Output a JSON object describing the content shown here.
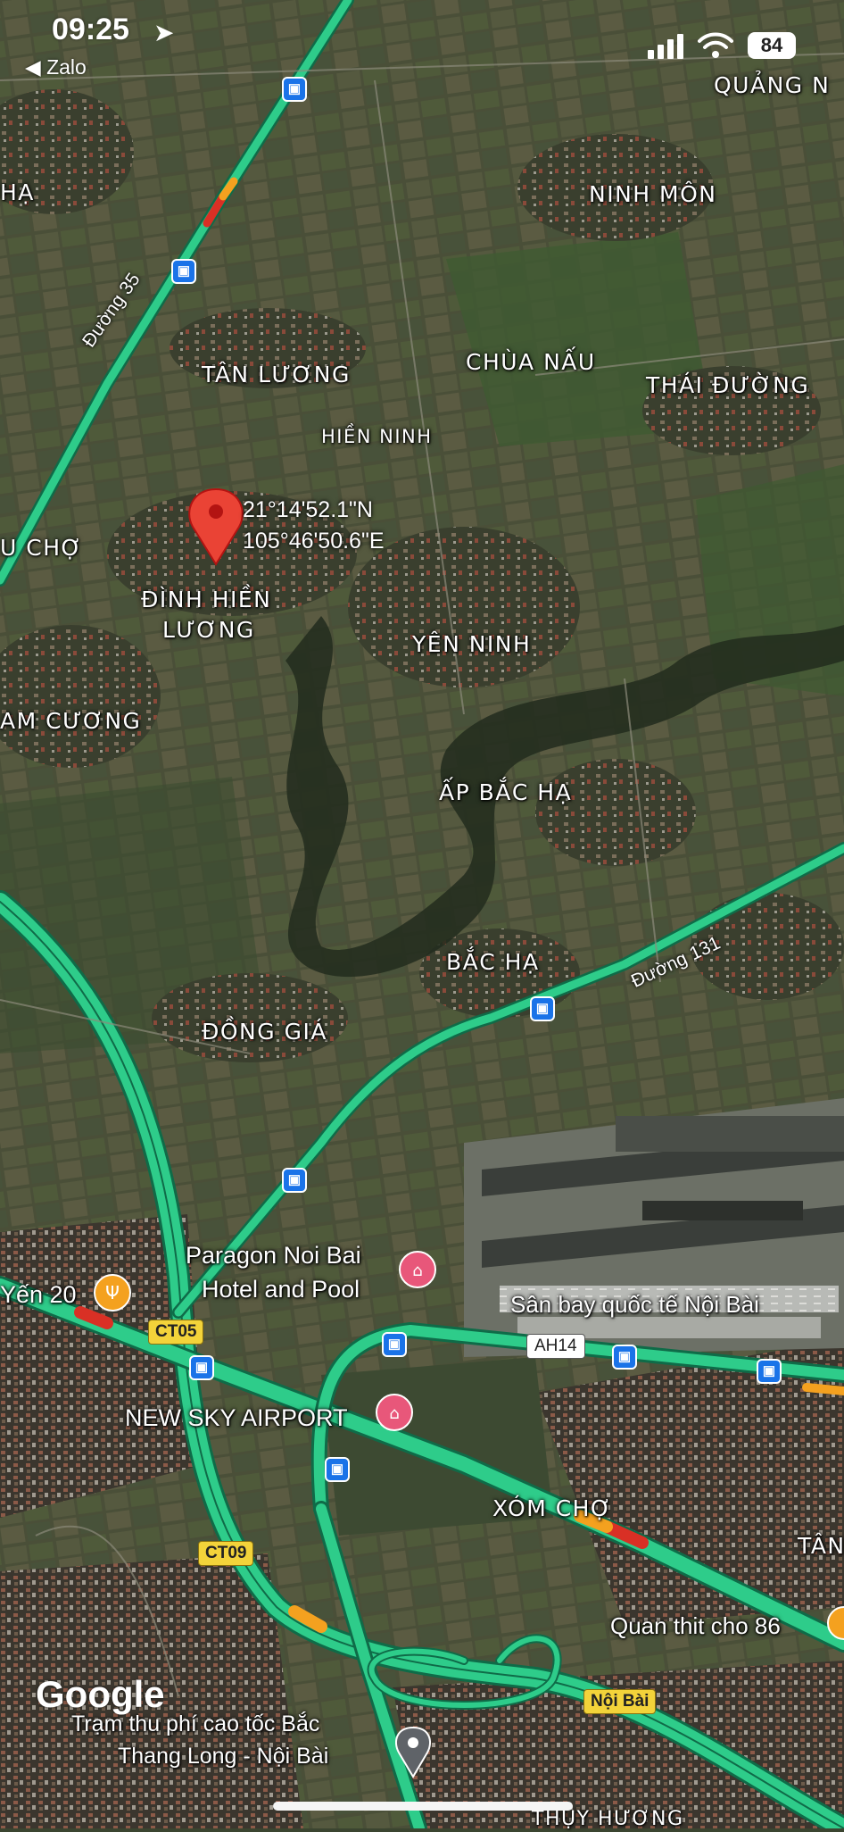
{
  "status_bar": {
    "time": "09:25",
    "back_app": "◀ Zalo",
    "battery": "84"
  },
  "pin": {
    "lat": "21°14'52.1\"N",
    "lng": "105°46'50.6\"E"
  },
  "places": {
    "quang_n": "QUẢNG N",
    "ha": "HẠ",
    "ninh_mon": "NINH MÔN",
    "tan_luong": "TÂN LƯƠNG",
    "chua_nau": "CHÙA NẤU",
    "thai_duong": "THÁI ĐƯỜNG",
    "hien_ninh": "HIỀN NINH",
    "u_cho": "U CHỢ",
    "dinh_hien_1": "ĐÌNH HIỀN",
    "dinh_hien_2": "LƯƠNG",
    "yen_ninh": "YÊN NINH",
    "am_cuong": "AM CƯƠNG",
    "ap_bac_ha": "ẤP BẮC HẠ",
    "bac_ha": "BẮC HẠ",
    "dong_gia": "ĐỒNG GIÁ",
    "xom_cho": "XÓM CHỢ",
    "tan_partial": "TÂN",
    "thuy_huong": "THỤY HƯƠNG"
  },
  "pois": {
    "paragon_1": "Paragon Noi Bai",
    "paragon_2": "Hotel and Pool",
    "yen20": "Yến 20",
    "airport": "Sân bay quốc tế Nội Bài",
    "new_sky": "NEW SKY AIRPORT",
    "quan_thit": "Quan thit cho 86",
    "toll_1": "Trạm thu phí cao tốc Bắc",
    "toll_2": "Thang Long - Nội Bài"
  },
  "roads": {
    "duong35": "Đường 35",
    "duong131": "Đường 131",
    "ct05": "CT05",
    "ct09": "CT09",
    "ah14": "AH14",
    "noi_bai": "Nội Bài"
  },
  "logo": "Google",
  "colors": {
    "highway": "#2ecc8a",
    "highway_edge": "#0f6b48",
    "traffic_red": "#d93025",
    "traffic_orange": "#f4a11f",
    "pin": "#ea4335",
    "bus": "#1a73e8",
    "shield": "#f3d33a",
    "poi_pink": "#e8577a",
    "poi_orange": "#f4a11f"
  }
}
